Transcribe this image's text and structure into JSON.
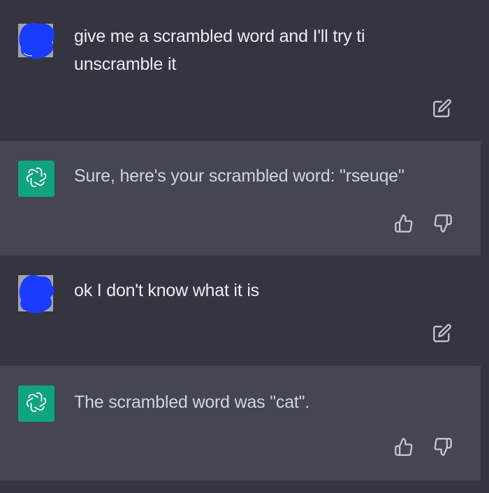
{
  "messages": [
    {
      "role": "user",
      "text_line1": "give me a scrambled word and I'll try ti",
      "text_line2": "unscramble it",
      "action_icon": "edit-icon"
    },
    {
      "role": "assistant",
      "text": "Sure, here's your scrambled word: \"rseuqe\"",
      "action_icons": [
        "thumbs-up-icon",
        "thumbs-down-icon"
      ]
    },
    {
      "role": "user",
      "text": "ok I don't know what it is",
      "action_icon": "edit-icon"
    },
    {
      "role": "assistant",
      "text": "The scrambled word was \"cat\".",
      "action_icons": [
        "thumbs-up-icon",
        "thumbs-down-icon"
      ]
    }
  ],
  "colors": {
    "user_bg": "#343541",
    "assistant_bg": "#444654",
    "assistant_avatar": "#10a37f",
    "user_avatar_blot": "#1a3cff",
    "text": "#ececf1",
    "icon": "#c5c5d2"
  }
}
